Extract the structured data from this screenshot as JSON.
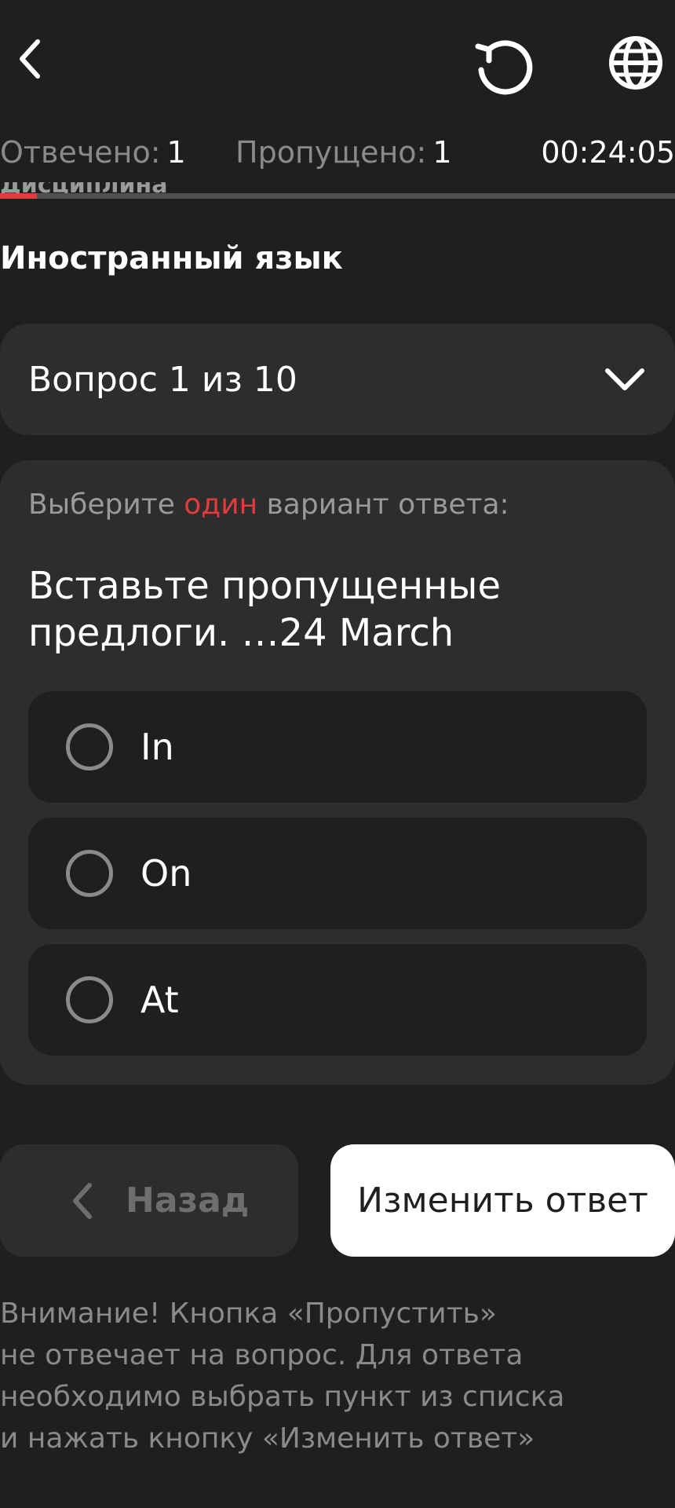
{
  "header": {
    "back_icon": "chevron-left-icon",
    "refresh_icon": "refresh-icon",
    "language_icon": "globe-icon"
  },
  "stats": {
    "answered_label": "Отвечено:",
    "answered_value": "1",
    "skipped_label": "Пропущено:",
    "skipped_value": "1",
    "timer": "00:24:05",
    "progress": 0.055
  },
  "discipline": {
    "label": "Дисциплина",
    "title": "Иностранный язык"
  },
  "question_selector": {
    "label": "Вопрос 1 из 10"
  },
  "question": {
    "instruction_before": "Выберите ",
    "instruction_accent": "один",
    "instruction_after": " вариант ответа:",
    "text_line1": "Вставьте пропущенные",
    "text_line2": "предлоги. …24 March",
    "options": [
      {
        "label": "In"
      },
      {
        "label": "On"
      },
      {
        "label": "At"
      }
    ]
  },
  "actions": {
    "back_label": "Назад",
    "change_answer_label": "Изменить ответ"
  },
  "notice": {
    "line1": "Внимание! Кнопка «Пропустить»",
    "line2": "не отвечает на вопрос. Для ответа",
    "line3": "необходимо выбрать пункт из списка",
    "line4": "и нажать кнопку «Изменить ответ»"
  },
  "colors": {
    "background": "#1f1f1f",
    "card": "#2d2d2d",
    "accent": "#e33b3b",
    "muted": "#8a8a8a"
  }
}
